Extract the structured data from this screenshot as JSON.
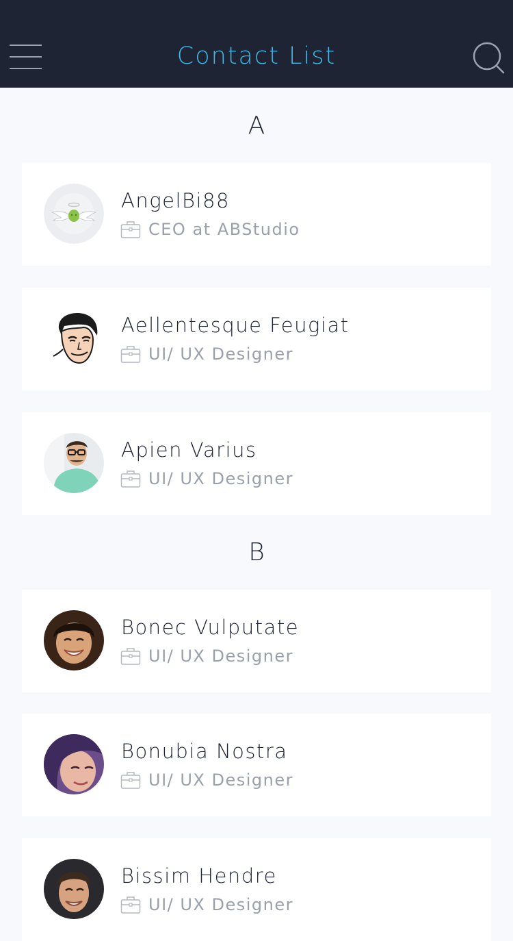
{
  "header": {
    "title": "Contact List",
    "menu_icon": "hamburger-menu-icon",
    "search_icon": "search-icon",
    "background": "#1e2433",
    "title_color": "#3fb8e6"
  },
  "sections": [
    {
      "letter": "A",
      "contacts": [
        {
          "name": "AngelBi88",
          "role": "CEO at ABStudio",
          "avatar": "angel-wings-logo"
        },
        {
          "name": "Aellentesque Feugiat",
          "role": "UI/ UX Designer",
          "avatar": "cartoon-man-face"
        },
        {
          "name": "Apien Varius",
          "role": "UI/ UX Designer",
          "avatar": "man-with-glasses-photo"
        }
      ]
    },
    {
      "letter": "B",
      "contacts": [
        {
          "name": "Bonec Vulputate",
          "role": "UI/ UX Designer",
          "avatar": "smiling-woman-photo"
        },
        {
          "name": "Bonubia Nostra",
          "role": "UI/ UX Designer",
          "avatar": "woman-purple-hair-photo"
        },
        {
          "name": "Bissim Hendre",
          "role": "UI/ UX Designer",
          "avatar": "smiling-man-photo"
        }
      ]
    }
  ],
  "role_icon": "briefcase-icon"
}
